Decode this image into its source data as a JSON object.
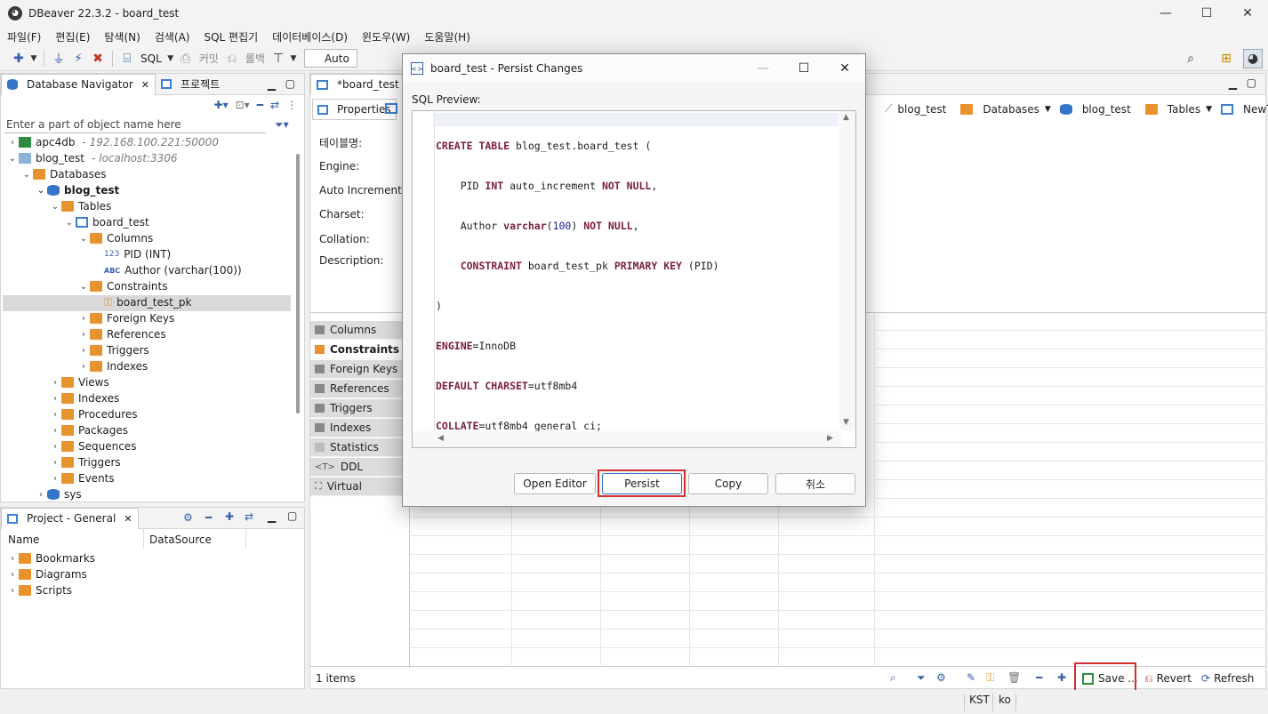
{
  "window": {
    "title": "DBeaver 22.3.2 - board_test",
    "min": "—",
    "max": "☐",
    "close": "✕"
  },
  "menu": [
    "파일(F)",
    "편집(E)",
    "탐색(N)",
    "검색(A)",
    "SQL 편집기",
    "데이터베이스(D)",
    "윈도우(W)",
    "도움말(H)"
  ],
  "toolbar": {
    "sql": "SQL",
    "commit": "커밋",
    "rollback": "롤백",
    "auto": "Auto"
  },
  "navigator": {
    "tab1": "Database Navigator",
    "tab2": "프로젝트",
    "filter_placeholder": "Enter a part of object name here",
    "tree": [
      {
        "label": "apc4db",
        "sub": "- 192.168.100.221:50000"
      },
      {
        "label": "blog_test",
        "sub": "- localhost:3306"
      },
      {
        "label": "Databases"
      },
      {
        "label": "blog_test"
      },
      {
        "label": "Tables"
      },
      {
        "label": "board_test"
      },
      {
        "label": "Columns"
      },
      {
        "label": "PID (INT)"
      },
      {
        "label": "Author (varchar(100))"
      },
      {
        "label": "Constraints"
      },
      {
        "label": "board_test_pk"
      },
      {
        "label": "Foreign Keys"
      },
      {
        "label": "References"
      },
      {
        "label": "Triggers"
      },
      {
        "label": "Indexes"
      },
      {
        "label": "Views"
      },
      {
        "label": "Indexes"
      },
      {
        "label": "Procedures"
      },
      {
        "label": "Packages"
      },
      {
        "label": "Sequences"
      },
      {
        "label": "Triggers"
      },
      {
        "label": "Events"
      },
      {
        "label": "sys"
      }
    ]
  },
  "project": {
    "tab": "Project - General",
    "col_name": "Name",
    "col_ds": "DataSource",
    "items": [
      "Bookmarks",
      "Diagrams",
      "Scripts"
    ]
  },
  "editor": {
    "tab": "*board_test",
    "properties_tab": "Properties",
    "fields": [
      "테이블명:",
      "Engine:",
      "Auto Increment:",
      "Charset:",
      "Collation:",
      "Description:"
    ],
    "breadcrumb": [
      "blog_test",
      "Databases",
      "blog_test",
      "Tables",
      "NewTable"
    ],
    "side_tabs": [
      "Columns",
      "Constraints",
      "Foreign Keys",
      "References",
      "Triggers",
      "Indexes",
      "Statistics",
      "DDL",
      "Virtual"
    ],
    "status_items": "1 items",
    "save": "Save ...",
    "revert": "Revert",
    "refresh": "Refresh"
  },
  "statusbar": {
    "tz": "KST",
    "locale": "ko"
  },
  "dialog": {
    "title": "board_test - Persist Changes",
    "label": "SQL Preview:",
    "sql_lines": [
      {
        "k1": "CREATE TABLE",
        "t1": " blog_test.board_test ("
      },
      {
        "t0": "    PID ",
        "k1": "INT",
        "t1": " auto_increment ",
        "k2": "NOT NULL",
        "t2": ","
      },
      {
        "t0": "    Author ",
        "k1": "varchar",
        "t1": "(",
        "n1": "100",
        "t2": ") ",
        "k2": "NOT NULL",
        "t3": ","
      },
      {
        "t0": "    ",
        "k1": "CONSTRAINT",
        "t1": " board_test_pk ",
        "k2": "PRIMARY KEY",
        "t2": " (PID)"
      },
      {
        "t0": ")"
      },
      {
        "k1": "ENGINE",
        "t1": "=InnoDB"
      },
      {
        "k1": "DEFAULT CHARSET",
        "t1": "=utf8mb4"
      },
      {
        "k1": "COLLATE",
        "t1": "=utf8mb4_general_ci;"
      }
    ],
    "buttons": {
      "open_editor": "Open Editor",
      "persist": "Persist",
      "copy": "Copy",
      "cancel": "취소"
    }
  }
}
